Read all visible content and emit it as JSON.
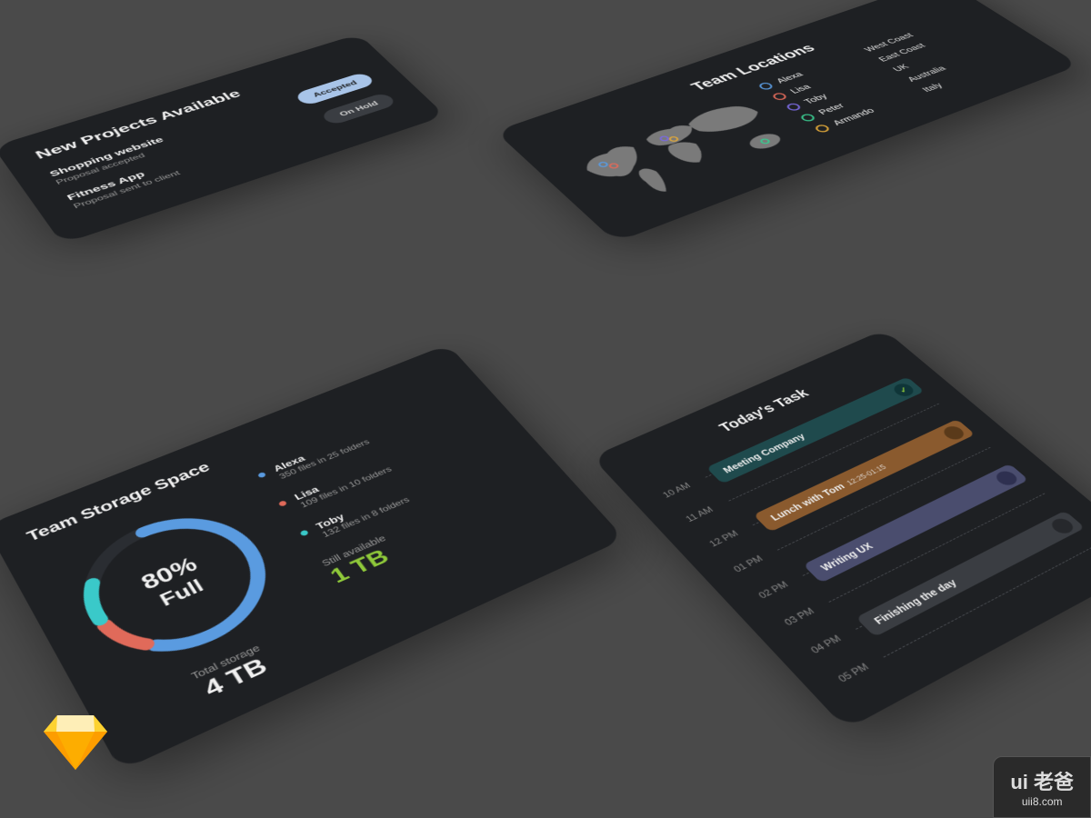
{
  "projects": {
    "title": "New Projects Available",
    "items": [
      {
        "name": "Shopping website",
        "sub": "Proposal accepted",
        "status": "Accepted"
      },
      {
        "name": "Fitness App",
        "sub": "Proposal sent to client",
        "status": "On Hold"
      }
    ]
  },
  "locations": {
    "title": "Team Locations",
    "people": [
      {
        "name": "Alexa",
        "color": "#5a9be0"
      },
      {
        "name": "Lisa",
        "color": "#e06a5a"
      },
      {
        "name": "Toby",
        "color": "#7a6ae0"
      },
      {
        "name": "Peter",
        "color": "#3ac98f"
      },
      {
        "name": "Armando",
        "color": "#e0a83a"
      }
    ],
    "regions": [
      "West Coast",
      "East Coast",
      "UK",
      "Australia",
      "Italy"
    ]
  },
  "storage": {
    "title": "Team Storage Space",
    "percent_label": "80%",
    "full_label": "Full",
    "total_label": "Total storage",
    "total_value": "4 TB",
    "avail_label": "Still available",
    "avail_value": "1 TB",
    "members": [
      {
        "name": "Alexa",
        "detail": "350 files in 25 folders",
        "color": "#5a9be0"
      },
      {
        "name": "Lisa",
        "detail": "109 files in 10 folders",
        "color": "#e06a5a"
      },
      {
        "name": "Toby",
        "detail": "132 files in 8 folders",
        "color": "#3ac9c9"
      }
    ]
  },
  "chart_data": {
    "type": "pie",
    "title": "Team Storage Space",
    "series": [
      {
        "name": "Alexa",
        "value": 60,
        "color": "#5a9be0"
      },
      {
        "name": "Lisa",
        "value": 10,
        "color": "#e06a5a"
      },
      {
        "name": "Toby",
        "value": 10,
        "color": "#3ac9c9"
      },
      {
        "name": "Free",
        "value": 20,
        "color": "transparent"
      }
    ],
    "center_label": "80% Full",
    "total": "4 TB",
    "available": "1 TB"
  },
  "tasks": {
    "title": "Today's Task",
    "hours": [
      "10 AM",
      "11 AM",
      "12 PM",
      "01 PM",
      "02 PM",
      "03 PM",
      "04 PM",
      "05 PM"
    ],
    "events": [
      {
        "title": "Meeting Company",
        "start": 0,
        "cls": "ev-teal",
        "done": true,
        "sub": ""
      },
      {
        "title": "Lunch with Tom",
        "start": 2,
        "cls": "ev-orange",
        "done": false,
        "sub": "12:25-01:15"
      },
      {
        "title": "Writing UX",
        "start": 4,
        "cls": "ev-purple",
        "done": false,
        "sub": ""
      },
      {
        "title": "Finishing the day",
        "start": 6,
        "cls": "ev-slate",
        "done": false,
        "sub": ""
      }
    ]
  },
  "watermark": {
    "brand": "ui 老爸",
    "url": "uii8.com"
  }
}
